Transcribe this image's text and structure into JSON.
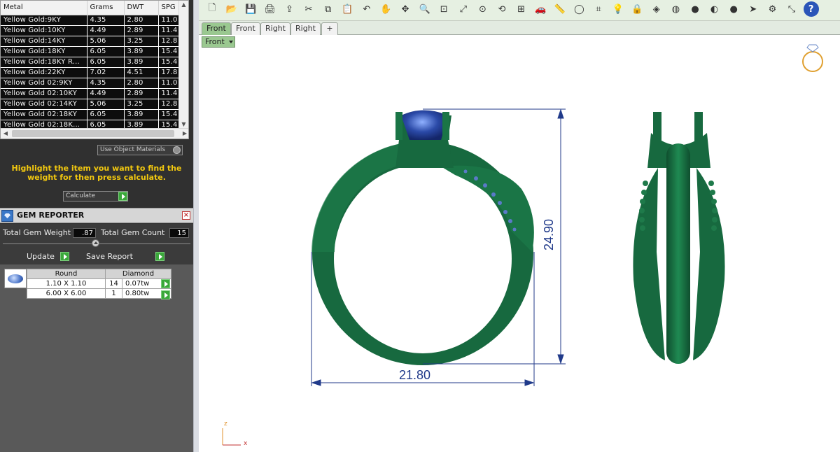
{
  "metal_table": {
    "columns": [
      "Metal",
      "Grams",
      "DWT",
      "SPG"
    ],
    "rows": [
      {
        "metal": "Yellow Gold:9KY",
        "grams": "4.35",
        "dwt": "2.80",
        "spg": "11.0"
      },
      {
        "metal": "Yellow Gold:10KY",
        "grams": "4.49",
        "dwt": "2.89",
        "spg": "11.4"
      },
      {
        "metal": "Yellow Gold:14KY",
        "grams": "5.06",
        "dwt": "3.25",
        "spg": "12.8"
      },
      {
        "metal": "Yellow Gold:18KY",
        "grams": "6.05",
        "dwt": "3.89",
        "spg": "15.4"
      },
      {
        "metal": "Yellow Gold:18KY R...",
        "grams": "6.05",
        "dwt": "3.89",
        "spg": "15.4"
      },
      {
        "metal": "Yellow Gold:22KY",
        "grams": "7.02",
        "dwt": "4.51",
        "spg": "17.8"
      },
      {
        "metal": "Yellow Gold 02:9KY",
        "grams": "4.35",
        "dwt": "2.80",
        "spg": "11.0"
      },
      {
        "metal": "Yellow Gold 02:10KY",
        "grams": "4.49",
        "dwt": "2.89",
        "spg": "11.4"
      },
      {
        "metal": "Yellow Gold 02:14KY",
        "grams": "5.06",
        "dwt": "3.25",
        "spg": "12.8"
      },
      {
        "metal": "Yellow Gold 02:18KY",
        "grams": "6.05",
        "dwt": "3.89",
        "spg": "15.4"
      },
      {
        "metal": "Yellow Gold 02:18K...",
        "grams": "6.05",
        "dwt": "3.89",
        "spg": "15.4"
      }
    ]
  },
  "use_object_materials_label": "Use Object Materials",
  "highlight_instruction": "Highlight the item you want to find the weight for then press calculate.",
  "calculate_label": "Calculate",
  "gem_reporter": {
    "title": "GEM REPORTER",
    "total_gem_weight_label": "Total Gem Weight",
    "total_gem_weight_value": ".87",
    "total_gem_count_label": "Total Gem Count",
    "total_gem_count_value": "15",
    "update_label": "Update",
    "save_report_label": "Save Report",
    "table": {
      "shape_header": "Round",
      "stone_header": "Diamond",
      "rows": [
        {
          "size": "1.10 X 1.10",
          "count": "14",
          "weight": "0.07tw"
        },
        {
          "size": "6.00 X 6.00",
          "count": "1",
          "weight": "0.80tw"
        }
      ]
    }
  },
  "view_tabs": [
    "Front",
    "Front",
    "Right",
    "Right"
  ],
  "active_view": "Front",
  "viewport_label": "Front",
  "dimensions": {
    "width": "21.80",
    "height": "24.90"
  },
  "axis_labels": {
    "z": "z",
    "x": "x"
  },
  "colors": {
    "ring_green": "#17693f",
    "gem_blue": "#2b4aa8",
    "dimension_blue": "#203a8a",
    "highlight_yellow": "#f2c80f"
  },
  "toolbar_icons": [
    "new-file-icon",
    "open-folder-icon",
    "save-icon",
    "print-icon",
    "export-icon",
    "cut-icon",
    "copy-icon",
    "paste-icon",
    "undo-icon",
    "pan-hand-icon",
    "move-icon",
    "zoom-icon",
    "zoom-window-icon",
    "zoom-extents-icon",
    "zoom-selected-icon",
    "rotate-view-icon",
    "viewport-grid-icon",
    "car-icon",
    "ruler-icon",
    "circle-icon",
    "snap-icon",
    "light-icon",
    "lock-icon",
    "layer-icon",
    "color-wheel-icon",
    "sphere-icon",
    "material-sphere-icon",
    "render-sphere-icon",
    "cursor-icon",
    "settings-icon",
    "resize-icon",
    "help-icon"
  ]
}
